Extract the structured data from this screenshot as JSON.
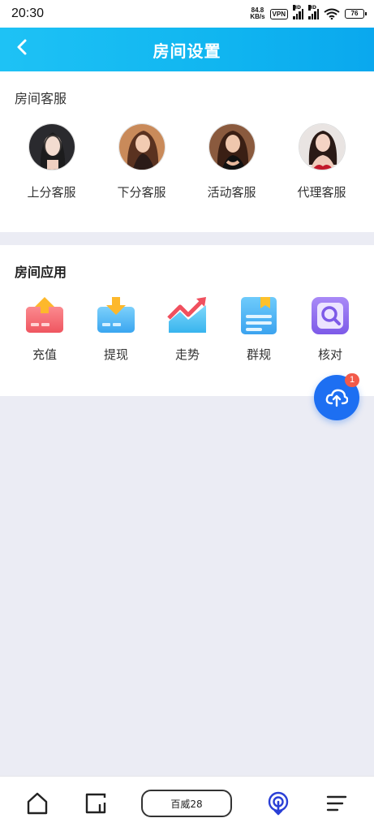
{
  "status_bar": {
    "time": "20:30",
    "net_speed_value": "84.8",
    "net_speed_unit": "KB/s",
    "vpn": "VPN",
    "hd1": "HD",
    "hd2": "HD",
    "battery": "76"
  },
  "header": {
    "title": "房间设置",
    "back_icon": "chevron-left-icon"
  },
  "customer_service": {
    "title": "房间客服",
    "items": [
      {
        "label": "上分客服"
      },
      {
        "label": "下分客服"
      },
      {
        "label": "活动客服"
      },
      {
        "label": "代理客服"
      }
    ]
  },
  "room_apps": {
    "title": "房间应用",
    "items": [
      {
        "label": "充值",
        "icon": "recharge-card-icon"
      },
      {
        "label": "提现",
        "icon": "withdraw-card-icon"
      },
      {
        "label": "走势",
        "icon": "trend-chart-icon"
      },
      {
        "label": "群规",
        "icon": "group-rules-doc-icon"
      },
      {
        "label": "核对",
        "icon": "verify-search-icon"
      }
    ]
  },
  "fab": {
    "icon": "cloud-upload-icon",
    "badge": "1",
    "color": "#1d6ff2"
  },
  "bottom_nav": {
    "center_label": "百威28",
    "accent_color": "#2a3fd6"
  },
  "colors": {
    "header_start": "#1ec2f5",
    "header_end": "#0aa8ee",
    "page_bg": "#ebecf4"
  }
}
